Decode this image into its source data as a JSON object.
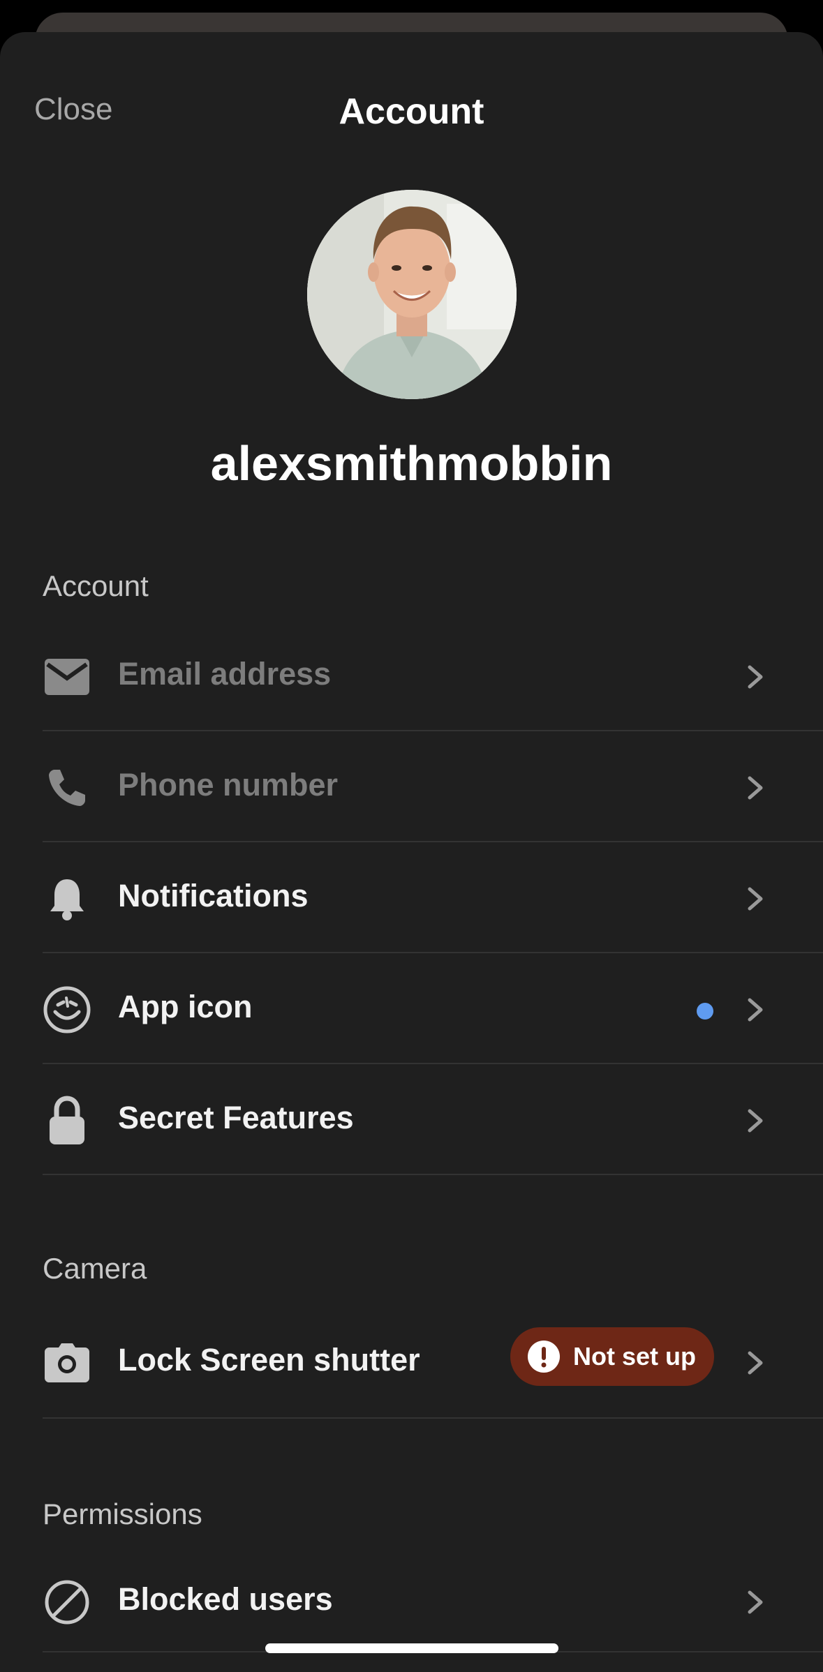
{
  "nav": {
    "close_label": "Close",
    "title": "Account"
  },
  "profile": {
    "username": "alexsmithmobbin"
  },
  "sections": {
    "account": {
      "header": "Account",
      "items": [
        {
          "label": "Email address",
          "icon": "mail-icon"
        },
        {
          "label": "Phone number",
          "icon": "phone-icon"
        },
        {
          "label": "Notifications",
          "icon": "bell-icon"
        },
        {
          "label": "App icon",
          "icon": "smiley-icon",
          "indicator": "new-dot"
        },
        {
          "label": "Secret Features",
          "icon": "lock-icon"
        }
      ]
    },
    "camera": {
      "header": "Camera",
      "items": [
        {
          "label": "Lock Screen shutter",
          "icon": "camera-icon",
          "badge": "Not set up"
        }
      ]
    },
    "permissions": {
      "header": "Permissions",
      "items": [
        {
          "label": "Blocked users",
          "icon": "blocked-icon"
        }
      ]
    }
  },
  "colors": {
    "background": "#1f1f1f",
    "dot_accent": "#5f9bf0",
    "badge_bg": "#6e2716"
  }
}
